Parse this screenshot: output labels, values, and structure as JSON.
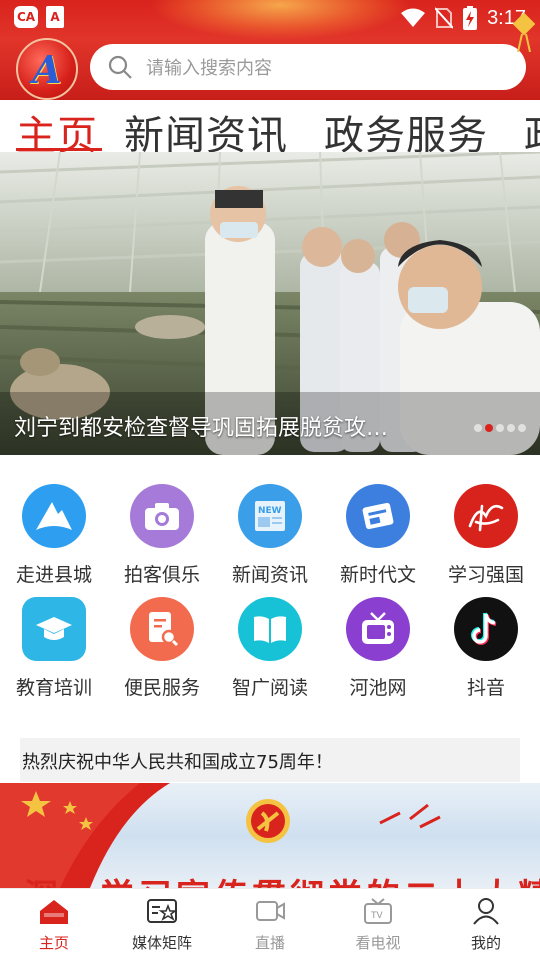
{
  "status_bar": {
    "time": "3:17",
    "left_icons": [
      "ca-app-icon",
      "a-app-icon"
    ],
    "right_icons": [
      "wifi-icon",
      "no-sim-icon",
      "battery-charging-icon"
    ]
  },
  "header": {
    "logo_letter": "A",
    "search_placeholder": "请输入搜索内容"
  },
  "tabs": [
    {
      "label": "主页",
      "active": true
    },
    {
      "label": "新闻资讯",
      "active": false
    },
    {
      "label": "政务服务",
      "active": false
    },
    {
      "label": "政",
      "active": false
    }
  ],
  "banner": {
    "caption": "刘宁到都安检查督导巩固拓展脱贫攻…",
    "slide_count": 5,
    "active_slide": 2
  },
  "grid": [
    {
      "label": "走进县城",
      "icon": "mountain-icon",
      "color": "#2d9ef0"
    },
    {
      "label": "拍客俱乐",
      "icon": "camera-icon",
      "color": "#a57ad8"
    },
    {
      "label": "新闻资讯",
      "icon": "newspaper-icon",
      "color": "#3a9ee8"
    },
    {
      "label": "新时代文",
      "icon": "news-card-icon",
      "color": "#3c7fde"
    },
    {
      "label": "学习强国",
      "icon": "xuexi-logo-icon",
      "color": "#d8231d"
    },
    {
      "label": "教育培训",
      "icon": "graduation-cap-icon",
      "color": "#2eb6e6"
    },
    {
      "label": "便民服务",
      "icon": "document-search-icon",
      "color": "#f26b4e"
    },
    {
      "label": "智广阅读",
      "icon": "open-book-icon",
      "color": "#18c2d6"
    },
    {
      "label": "河池网",
      "icon": "tv-icon",
      "color": "#8a3fd0"
    },
    {
      "label": "抖音",
      "icon": "tiktok-icon",
      "color": "#111111"
    }
  ],
  "notice": {
    "text": "热烈庆祝中华人民共和国成立75周年！"
  },
  "promo": {
    "text": "深入学习宣传贯彻党的二十大精神"
  },
  "bottom_nav": [
    {
      "label": "主页",
      "icon": "home-icon",
      "state": "active"
    },
    {
      "label": "媒体矩阵",
      "icon": "media-matrix-icon",
      "state": "normal"
    },
    {
      "label": "直播",
      "icon": "live-camera-icon",
      "state": "dim"
    },
    {
      "label": "看电视",
      "icon": "tv-watch-icon",
      "state": "dim"
    },
    {
      "label": "我的",
      "icon": "user-icon",
      "state": "normal"
    }
  ],
  "colors": {
    "brand_red": "#d9231d",
    "text": "#333333",
    "muted": "#999999"
  }
}
